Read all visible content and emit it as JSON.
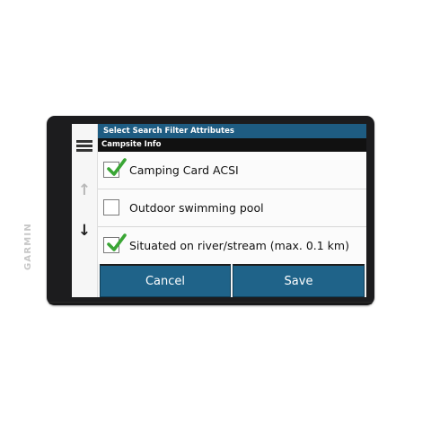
{
  "device": {
    "brand": "GARMIN"
  },
  "header": {
    "title": "Select Search Filter Attributes",
    "subtitle": "Campsite Info"
  },
  "sidebar": {
    "menu_icon": "hamburger-menu-icon",
    "scroll_up_icon": "arrow-up-icon",
    "scroll_down_icon": "arrow-down-icon"
  },
  "options": [
    {
      "label": "Camping Card ACSI",
      "checked": true
    },
    {
      "label": "Outdoor swimming pool",
      "checked": false
    },
    {
      "label": "Situated on river/stream (max. 0.1 km)",
      "checked": true
    }
  ],
  "actions": {
    "cancel_label": "Cancel",
    "save_label": "Save"
  },
  "colors": {
    "title_bar": "#1e5c82",
    "subtitle_bar": "#111111",
    "button": "#1f6389",
    "checkmark": "#3aa635"
  }
}
